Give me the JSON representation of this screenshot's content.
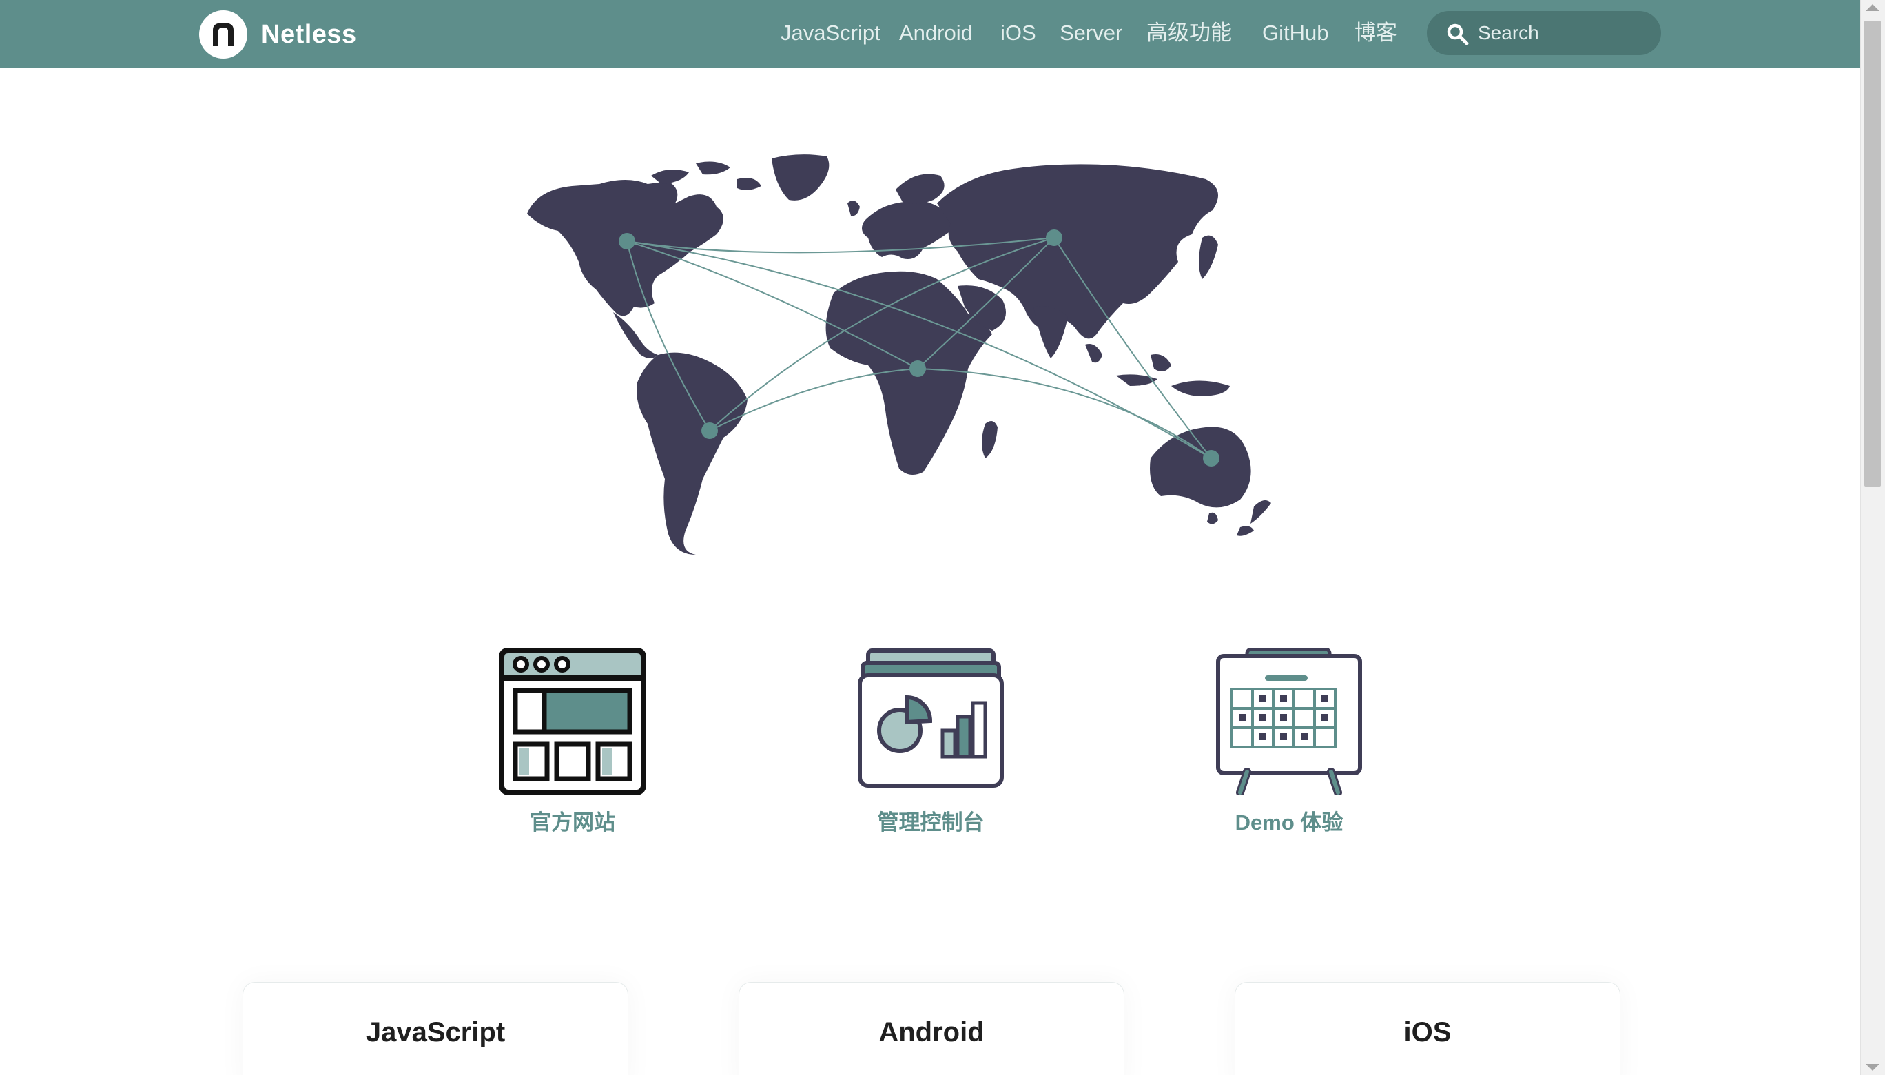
{
  "brand": {
    "name": "Netless",
    "logo_letter": "n"
  },
  "nav": {
    "links": [
      "JavaScript",
      "Android",
      "iOS",
      "Server",
      "高级功能",
      "GitHub",
      "博客"
    ],
    "search_placeholder": "Search"
  },
  "features": [
    {
      "label": "官方网站",
      "icon": "browser-window-icon"
    },
    {
      "label": "管理控制台",
      "icon": "dashboard-chart-icon"
    },
    {
      "label": "Demo 体验",
      "icon": "calendar-board-icon"
    }
  ],
  "platform_cards": [
    "JavaScript",
    "Android",
    "iOS"
  ],
  "colors": {
    "primary": "#5e8e8b",
    "map_land": "#3f3d56",
    "accent_light": "#a9c5c3",
    "text_dark": "#1f1f1f"
  }
}
